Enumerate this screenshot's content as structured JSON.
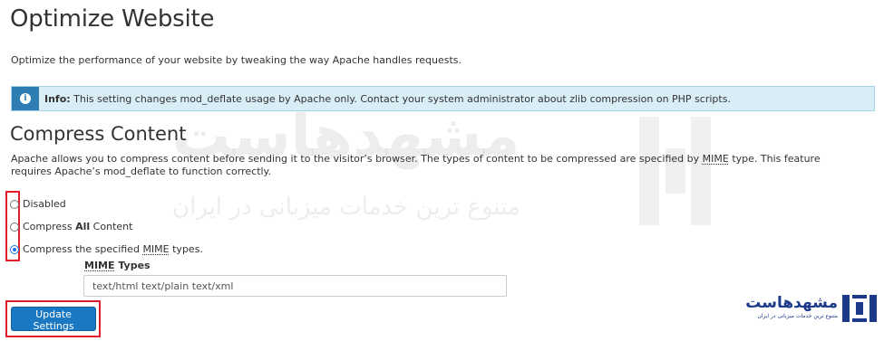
{
  "page": {
    "title": "Optimize Website",
    "description": "Optimize the performance of your website by tweaking the way Apache handles requests."
  },
  "info": {
    "label": "Info:",
    "text": "This setting changes mod_deflate usage by Apache only. Contact your system administrator about zlib compression on PHP scripts.",
    "icon": "info-icon"
  },
  "compress": {
    "title": "Compress Content",
    "desc_before": "Apache allows you to compress content before sending it to the visitor’s browser. The types of content to be compressed are specified by ",
    "desc_abbr": "MIME",
    "desc_after": " type. This feature requires Apache’s mod_deflate to function correctly.",
    "options": [
      {
        "prefix": "Disabled",
        "bold": "",
        "suffix": "",
        "checked": false
      },
      {
        "prefix": "Compress ",
        "bold": "All",
        "suffix": " Content",
        "checked": false
      },
      {
        "prefix": "Compress the specified ",
        "bold": "MIME",
        "suffix": " types.",
        "checked": true
      }
    ],
    "mime_label_abbr": "MIME",
    "mime_label_rest": " Types",
    "mime_value": "text/html text/plain text/xml",
    "update_button": "Update Settings"
  },
  "watermark": {
    "main": "مشهدهاست",
    "sub": "متنوع ترین خدمات میزبانی در ایران"
  },
  "logo": {
    "name": "مشهدهاست",
    "tagline": "متنوع ترین خدمات میزبانی در ایران"
  },
  "colors": {
    "primary_button": "#1a78c2",
    "info_background": "#d9edf7",
    "info_accent": "#2d7db3",
    "highlight": "#e11d2b",
    "brand": "#1d3a8a"
  }
}
